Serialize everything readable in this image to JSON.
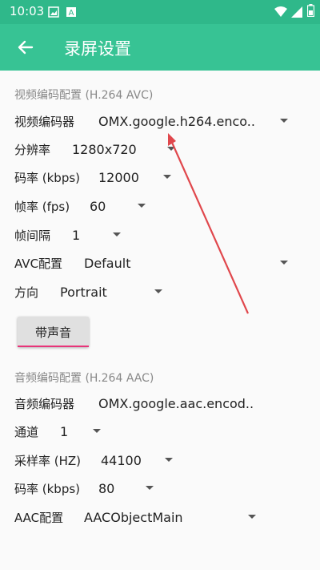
{
  "status_bar": {
    "time": "10:03"
  },
  "app_bar": {
    "title": "录屏设置"
  },
  "video": {
    "section_title": "视频编码配置 (H.264 AVC)",
    "encoder": {
      "label": "视频编码器",
      "value": "OMX.google.h264.enco.."
    },
    "resolution": {
      "label": "分辨率",
      "value": "1280x720"
    },
    "bitrate": {
      "label": "码率 (kbps)",
      "value": "12000"
    },
    "framerate": {
      "label": "帧率 (fps)",
      "value": "60"
    },
    "iframe_interval": {
      "label": "帧间隔",
      "value": "1"
    },
    "avc_profile": {
      "label": "AVC配置",
      "value": "Default"
    },
    "orientation": {
      "label": "方向",
      "value": "Portrait"
    }
  },
  "audio_toggle": {
    "label": "带声音"
  },
  "audio": {
    "section_title": "音频编码配置 (H.264 AAC)",
    "encoder": {
      "label": "音频编码器",
      "value": "OMX.google.aac.encod.."
    },
    "channels": {
      "label": "通道",
      "value": "1"
    },
    "sample_rate": {
      "label": "采样率 (HZ)",
      "value": "44100"
    },
    "bitrate": {
      "label": "码率 (kbps)",
      "value": "80"
    },
    "aac_profile": {
      "label": "AAC配置",
      "value": "AACObjectMain"
    }
  },
  "colors": {
    "status_bar": "#2fb88a",
    "app_bar": "#37c394",
    "annotation_arrow": "#e0474c",
    "button_accent": "#e8357a"
  }
}
